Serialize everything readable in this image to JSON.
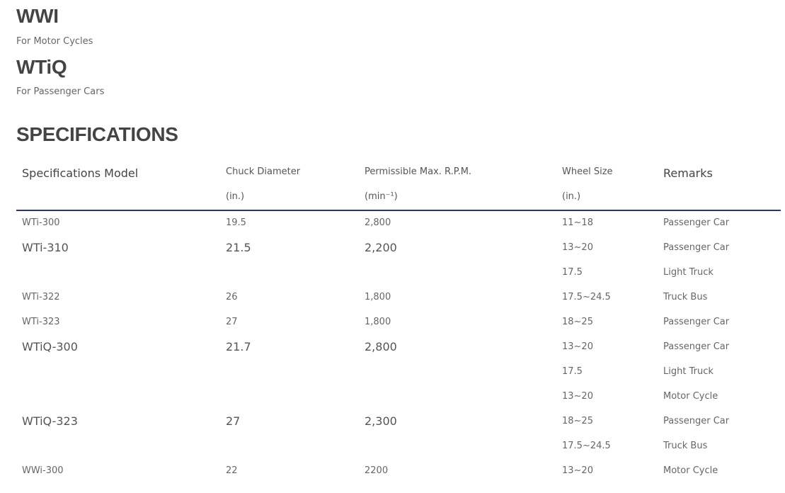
{
  "products": [
    {
      "name": "WWI",
      "description": "For Motor Cycles"
    },
    {
      "name": "WTiQ",
      "description": "For Passenger Cars"
    }
  ],
  "specifications": {
    "heading": "SPECIFICATIONS",
    "columns": {
      "model": "Specifications Model",
      "chuck_diameter": "Chuck Diameter",
      "chuck_diameter_unit": "(in.)",
      "max_rpm": "Permissible Max. R.P.M.",
      "max_rpm_unit": "(min⁻¹)",
      "wheel_size": "Wheel Size",
      "wheel_size_unit": "(in.)",
      "remarks": "Remarks"
    },
    "rows": [
      {
        "model": "WTi-300",
        "chuck": "19.5",
        "rpm": "2,800",
        "wheel": "11~18",
        "remarks": "Passenger Car"
      },
      {
        "model": "WTi-310",
        "chuck": "21.5",
        "rpm": "2,200",
        "wheel": "13~20",
        "remarks": "Passenger Car"
      },
      {
        "model": "",
        "chuck": "",
        "rpm": "",
        "wheel": "17.5",
        "remarks": "Light Truck"
      },
      {
        "model": "WTi-322",
        "chuck": "26",
        "rpm": "1,800",
        "wheel": "17.5~24.5",
        "remarks": "Truck Bus"
      },
      {
        "model": "WTi-323",
        "chuck": "27",
        "rpm": "1,800",
        "wheel": "18~25",
        "remarks": "Passenger Car"
      },
      {
        "model": "WTiQ-300",
        "chuck": "21.7",
        "rpm": "2,800",
        "wheel": "13~20",
        "remarks": "Passenger Car"
      },
      {
        "model": "",
        "chuck": "",
        "rpm": "",
        "wheel": "17.5",
        "remarks": "Light Truck"
      },
      {
        "model": "",
        "chuck": "",
        "rpm": "",
        "wheel": "13~20",
        "remarks": "Motor Cycle"
      },
      {
        "model": "WTiQ-323",
        "chuck": "27",
        "rpm": "2,300",
        "wheel": "18~25",
        "remarks": "Passenger Car"
      },
      {
        "model": "",
        "chuck": "",
        "rpm": "",
        "wheel": "17.5~24.5",
        "remarks": "Truck Bus"
      },
      {
        "model": "WWi-300",
        "chuck": "22",
        "rpm": "2200",
        "wheel": "13~20",
        "remarks": "Motor Cycle"
      }
    ]
  }
}
